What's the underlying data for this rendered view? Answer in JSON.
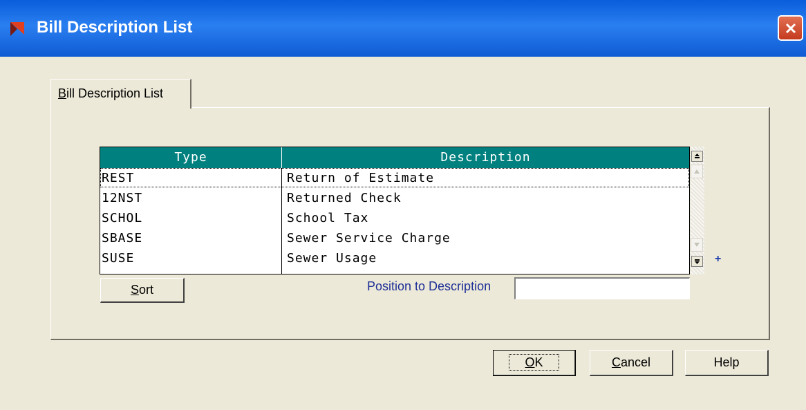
{
  "window": {
    "title": "Bill Description List",
    "close_icon": "close-x-icon"
  },
  "tab": {
    "label_accel": "B",
    "label_rest": "ill Description List"
  },
  "grid": {
    "columns": [
      "Type",
      "Description"
    ],
    "rows": [
      {
        "type": "REST",
        "description": "Return of Estimate"
      },
      {
        "type": "12NST",
        "description": "Returned Check"
      },
      {
        "type": "SCHOL",
        "description": "School Tax"
      },
      {
        "type": "SBASE",
        "description": "Sewer Service Charge"
      },
      {
        "type": "SUSE",
        "description": "Sewer Usage"
      }
    ],
    "header_color": "#00807e",
    "more_indicator": "+"
  },
  "sort_button": {
    "accel": "S",
    "rest": "ort"
  },
  "position": {
    "label": "Position to Description",
    "value": ""
  },
  "buttons": {
    "ok": {
      "accel": "O",
      "rest": "K"
    },
    "cancel": {
      "accel": "C",
      "rest": "ancel"
    },
    "help": {
      "label": "Help"
    }
  }
}
